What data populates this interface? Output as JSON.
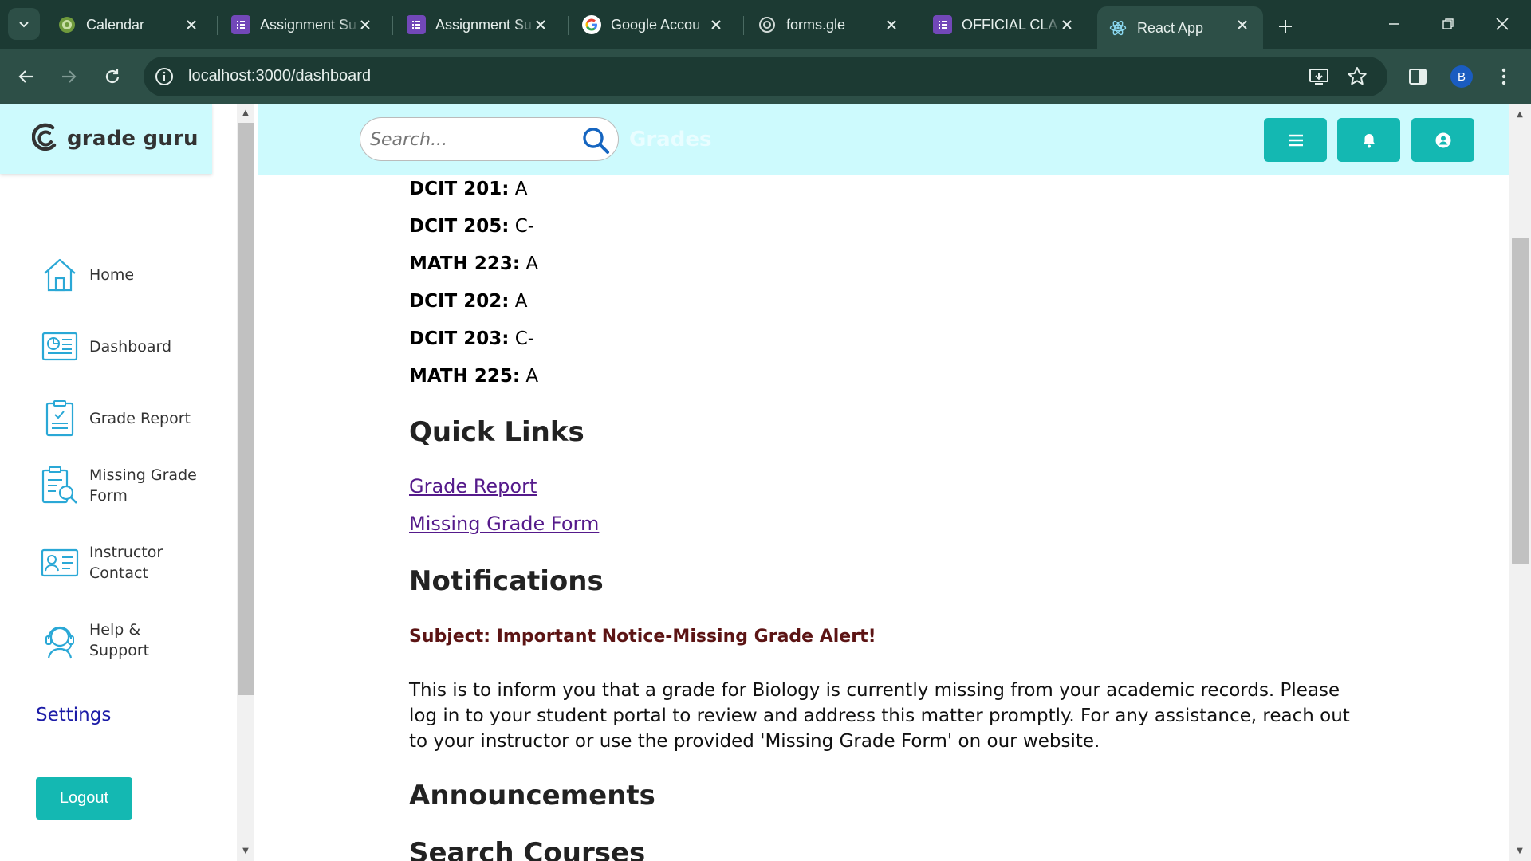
{
  "browser": {
    "tabs": [
      {
        "title": "Calendar",
        "favicon": "calendar-favicon",
        "color": "#8bbf5a"
      },
      {
        "title": "Assignment Su",
        "favicon": "forms-favicon",
        "color": "#7248b9"
      },
      {
        "title": "Assignment Su",
        "favicon": "forms-favicon",
        "color": "#7248b9"
      },
      {
        "title": "Google Accou",
        "favicon": "google-favicon",
        "color": "#ffffff"
      },
      {
        "title": "forms.gle",
        "favicon": "globe-favicon",
        "color": "#cccccc"
      },
      {
        "title": "OFFICIAL CLA",
        "favicon": "forms-favicon",
        "color": "#7248b9"
      },
      {
        "title": "React App",
        "favicon": "react-favicon",
        "color": "#61dafb"
      }
    ],
    "url": "localhost:3000/dashboard",
    "profile_initial": "B"
  },
  "sidebar": {
    "brand": "grade guru",
    "items": [
      {
        "label": "Home",
        "icon": "home-icon"
      },
      {
        "label": "Dashboard",
        "icon": "dashboard-icon"
      },
      {
        "label": "Grade Report",
        "icon": "grade-report-icon"
      },
      {
        "label": "Missing Grade Form",
        "icon": "missing-grade-form-icon"
      },
      {
        "label": "Instructor Contact",
        "icon": "instructor-contact-icon"
      },
      {
        "label": "Help & Support",
        "icon": "help-support-icon"
      }
    ],
    "settings": "Settings",
    "logout": "Logout"
  },
  "header": {
    "search_placeholder": "Search...",
    "title": "Grades"
  },
  "grades": [
    {
      "course": "DCIT 201:",
      "grade": "A"
    },
    {
      "course": "DCIT 205:",
      "grade": "C-"
    },
    {
      "course": "MATH 223:",
      "grade": "A"
    },
    {
      "course": "DCIT 202:",
      "grade": "A"
    },
    {
      "course": "DCIT 203:",
      "grade": "C-"
    },
    {
      "course": "MATH 225:",
      "grade": "A"
    }
  ],
  "quick_links": {
    "title": "Quick Links",
    "links": [
      "Grade Report",
      "Missing Grade Form"
    ]
  },
  "notifications": {
    "title": "Notifications",
    "subject": "Subject: Important Notice-Missing Grade Alert!",
    "body": "This is to inform you that a grade for Biology is currently missing from your academic records. Please log in to your student portal to review and address this matter promptly. For any assistance, reach out to your instructor or use the provided 'Missing Grade Form' on our website."
  },
  "announcements": {
    "title": "Announcements"
  },
  "search_courses": {
    "title": "Search Courses"
  },
  "colors": {
    "accent": "#14b8b2",
    "header_bg": "#cdfafd",
    "chrome": "#2d4f47",
    "link_visited": "#551a8b",
    "settings_link": "#1a1aa6"
  }
}
